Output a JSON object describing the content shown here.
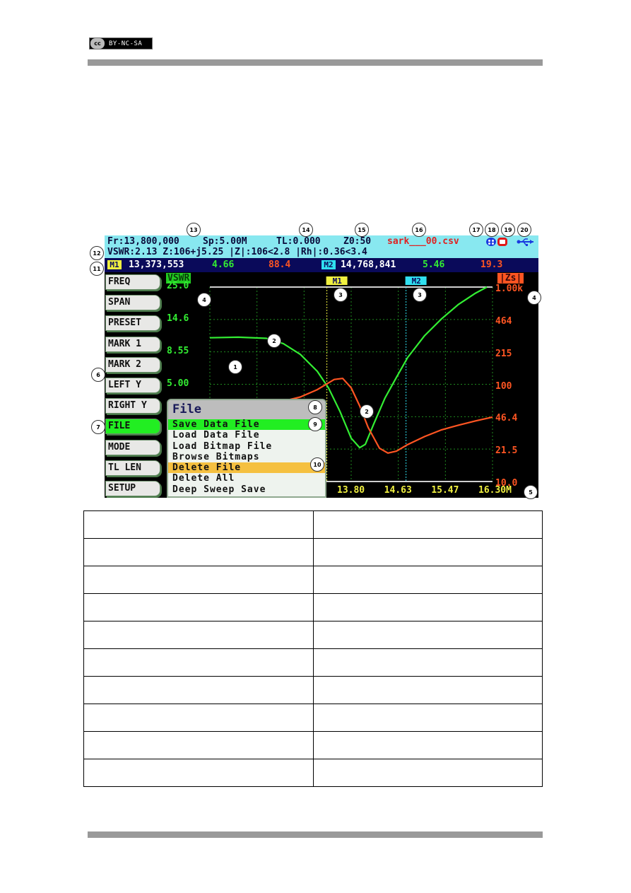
{
  "license_badge": {
    "cc": "cc",
    "label": "BY-NC-SA"
  },
  "header": {
    "line1": {
      "freq": "Fr:13,800,000",
      "span": "Sp:5.00M",
      "tl": "TL:0.000",
      "z0": "Z0:50",
      "filename": "sark___00.csv"
    },
    "line2": "VSWR:2.13 Z:106+j5.25 |Z|:106<2.8 |Rh|:0.36<3.4",
    "status_icons": [
      "sd-card-icon",
      "record-icon",
      "usb-icon"
    ]
  },
  "markers": {
    "m1": {
      "tag": "M1",
      "freq": "13,373,553",
      "vswr": "4.66",
      "z": "88.4"
    },
    "m2": {
      "tag": "M2",
      "freq": "14,768,841",
      "vswr": "5.46",
      "z": "19.3"
    }
  },
  "side_buttons": [
    "FREQ",
    "SPAN",
    "PRESET",
    "MARK 1",
    "MARK 2",
    "LEFT Y",
    "RIGHT Y",
    "FILE",
    "MODE",
    "TL LEN",
    "SETUP"
  ],
  "active_button": "FILE",
  "file_menu": {
    "title": "File",
    "items": [
      "Save Data File",
      "Load Data File",
      "Load Bitmap File",
      "Browse Bitmaps",
      "Delete File",
      "Delete All",
      "Deep Sweep Save"
    ],
    "selected": "Save Data File",
    "highlighted": "Delete File"
  },
  "colors": {
    "vswr": "#33ee33",
    "zs": "#ff5522",
    "m1": "#f0f040",
    "m2": "#30e0f0",
    "header_bg": "#88e8f0",
    "marker_bar_bg": "#0a0a5a"
  },
  "callouts": [
    "1",
    "2",
    "2",
    "3",
    "3",
    "4",
    "4",
    "5",
    "6",
    "7",
    "8",
    "9",
    "10",
    "11",
    "12",
    "13",
    "14",
    "15",
    "16",
    "17",
    "18",
    "19",
    "20"
  ],
  "chart_data": {
    "type": "line",
    "left_axis": {
      "label": "VSWR",
      "ticks": [
        "25.0",
        "14.6",
        "8.55",
        "5.00"
      ],
      "scale": "log",
      "ylim": [
        1.0,
        25.0
      ]
    },
    "right_axis": {
      "label": "|Zs|",
      "ticks": [
        "1.00k",
        "464",
        "215",
        "100",
        "46.4",
        "21.5",
        "10.0"
      ],
      "scale": "log",
      "ylim": [
        10.0,
        1000.0
      ]
    },
    "x_axis": {
      "ticks": [
        "13.80",
        "14.63",
        "15.47",
        "16.30M"
      ],
      "xlim": [
        11.3,
        16.3
      ],
      "unit": "MHz"
    },
    "markers": [
      {
        "name": "M1",
        "x": 13.37
      },
      {
        "name": "M2",
        "x": 14.77
      }
    ],
    "series": [
      {
        "name": "VSWR",
        "axis": "left",
        "x": [
          11.3,
          11.8,
          12.3,
          12.6,
          12.9,
          13.2,
          13.4,
          13.6,
          13.8,
          13.95,
          14.05,
          14.2,
          14.4,
          14.6,
          14.8,
          15.1,
          15.4,
          15.7,
          16.0,
          16.2
        ],
        "y": [
          10.8,
          10.9,
          10.7,
          9.8,
          8.2,
          6.2,
          4.7,
          3.2,
          2.05,
          1.75,
          1.85,
          2.6,
          4.0,
          5.6,
          7.8,
          11.2,
          14.8,
          18.8,
          22.6,
          25.0
        ]
      },
      {
        "name": "|Zs|",
        "axis": "right",
        "x": [
          12.55,
          12.9,
          13.2,
          13.5,
          13.65,
          13.8,
          13.95,
          14.1,
          14.3,
          14.45,
          14.6,
          14.8,
          15.1,
          15.4,
          15.7,
          16.0,
          16.3
        ],
        "y": [
          66,
          74,
          88,
          112,
          115,
          92,
          60,
          36,
          22,
          19.6,
          20.5,
          24,
          29,
          34,
          38,
          42,
          46
        ]
      }
    ]
  },
  "table": {
    "rows": [
      [
        "",
        ""
      ],
      [
        "",
        ""
      ],
      [
        "",
        ""
      ],
      [
        "",
        ""
      ],
      [
        "",
        ""
      ],
      [
        "",
        ""
      ],
      [
        "",
        ""
      ],
      [
        "",
        ""
      ],
      [
        "",
        ""
      ],
      [
        "",
        ""
      ]
    ]
  }
}
